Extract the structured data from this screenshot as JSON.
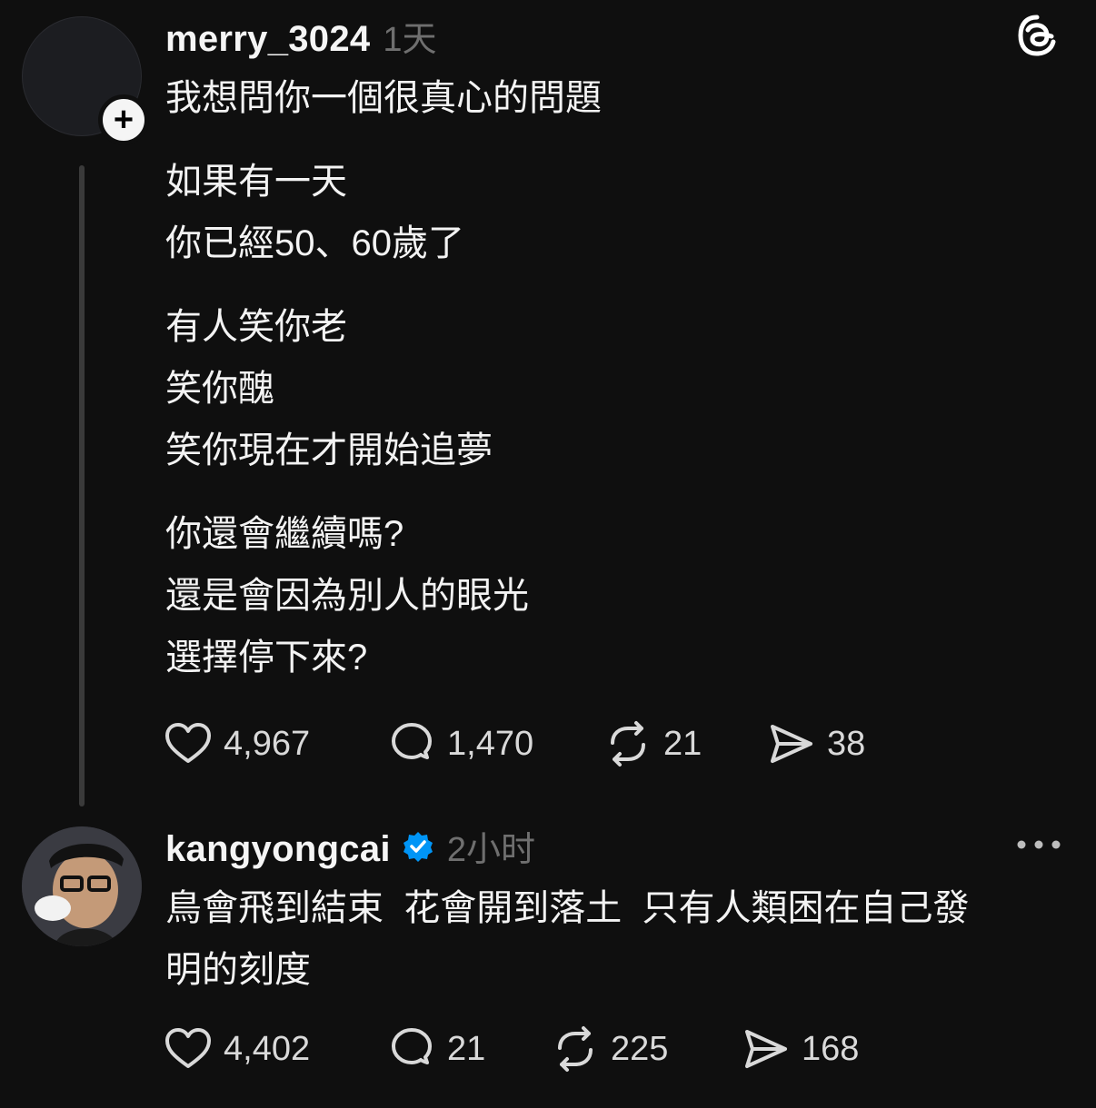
{
  "post1": {
    "username": "merry_3024",
    "time": "1天",
    "lines": [
      [
        "我想問你一個很真心的問題"
      ],
      [
        "如果有一天",
        "你已經50、60歲了"
      ],
      [
        "有人笑你老",
        "笑你醜",
        "笑你現在才開始追夢"
      ],
      [
        "你還會繼續嗎?",
        "還是會因為別人的眼光",
        "選擇停下來?"
      ]
    ],
    "stats": {
      "likes": "4,967",
      "comments": "1,470",
      "reposts": "21",
      "shares": "38"
    }
  },
  "post2": {
    "username": "kangyongcai",
    "time": "2小时",
    "lines": [
      "鳥會飛到結束  花會開到落土  只有人類困在自己發",
      "明的刻度"
    ],
    "stats": {
      "likes": "4,402",
      "comments": "21",
      "reposts": "225",
      "shares": "168"
    }
  },
  "icons": [
    "threads-logo-icon",
    "heart-icon",
    "comment-icon",
    "repost-icon",
    "share-icon",
    "verified-badge-icon",
    "more-icon",
    "plus-icon"
  ],
  "colors": {
    "background": "#0f0f0f",
    "text": "#f3f3f3",
    "muted": "#6f6f6f",
    "verified": "#0095f6"
  }
}
